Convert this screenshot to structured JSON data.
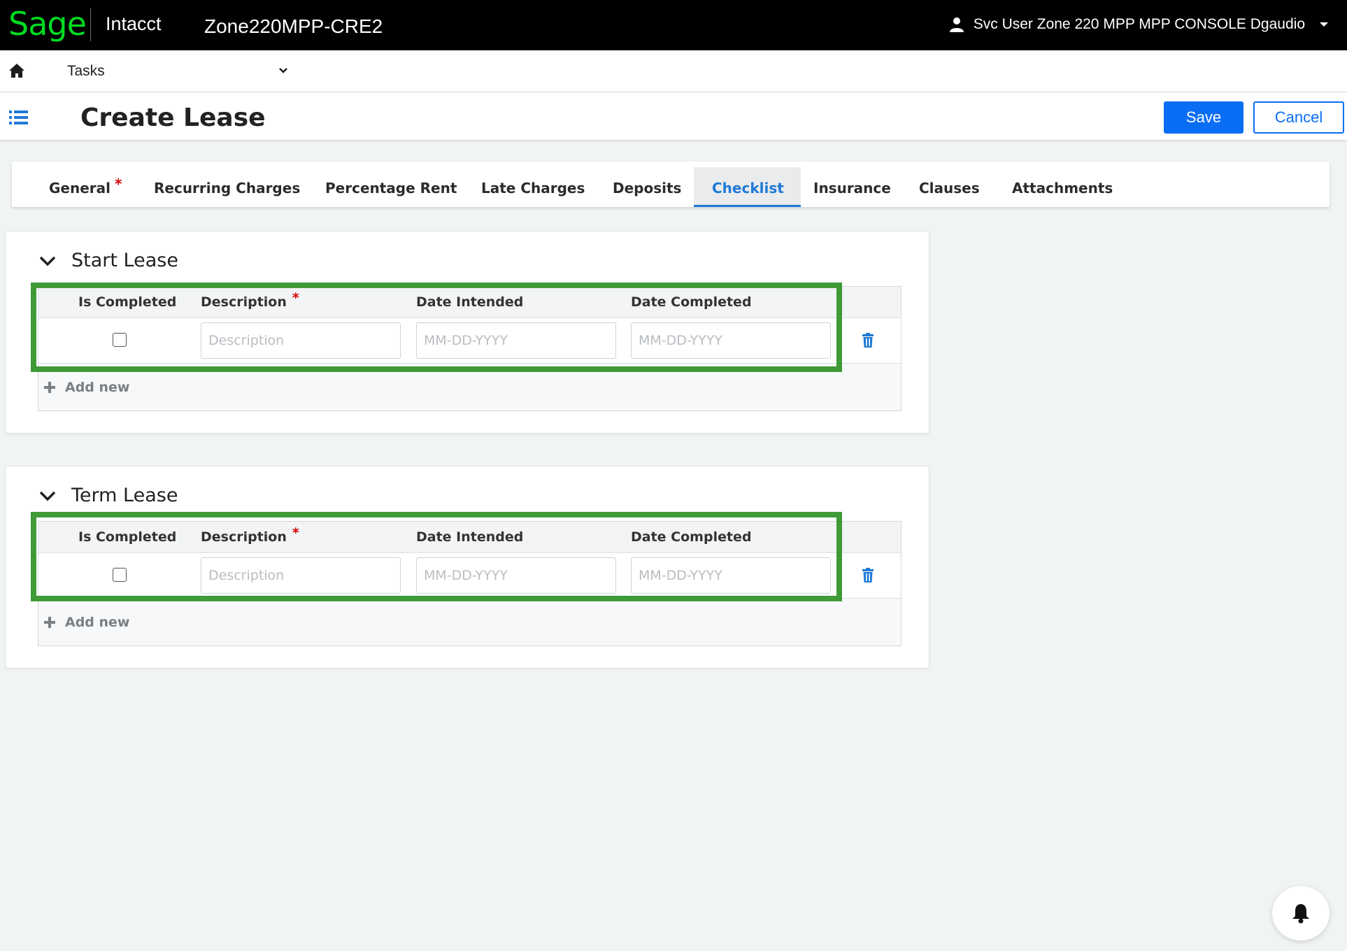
{
  "header": {
    "logo": "Sage",
    "product": "Intacct",
    "company": "Zone220MPP-CRE2",
    "user_name": "Svc User Zone 220 MPP MPP CONSOLE Dgaudio"
  },
  "nav": {
    "tasks_label": "Tasks"
  },
  "page": {
    "title": "Create Lease",
    "save_label": "Save",
    "cancel_label": "Cancel"
  },
  "tabs": [
    {
      "label": "General",
      "required_mark": "*"
    },
    {
      "label": "Recurring Charges"
    },
    {
      "label": "Percentage Rent"
    },
    {
      "label": "Late Charges"
    },
    {
      "label": "Deposits"
    },
    {
      "label": "Checklist",
      "active": true
    },
    {
      "label": "Insurance"
    },
    {
      "label": "Clauses"
    },
    {
      "label": "Attachments"
    }
  ],
  "sections": [
    {
      "title": "Start Lease",
      "columns": [
        "Is Completed",
        "Description",
        "Date Intended",
        "Date Completed"
      ],
      "required_mark": "*",
      "row": {
        "description_placeholder": "Description",
        "date_intended_placeholder": "MM-DD-YYYY",
        "date_completed_placeholder": "MM-DD-YYYY",
        "is_completed": false
      },
      "add_new_label": "Add new"
    },
    {
      "title": "Term Lease",
      "columns": [
        "Is Completed",
        "Description",
        "Date Intended",
        "Date Completed"
      ],
      "required_mark": "*",
      "row": {
        "description_placeholder": "Description",
        "date_intended_placeholder": "MM-DD-YYYY",
        "date_completed_placeholder": "MM-DD-YYYY",
        "is_completed": false
      },
      "add_new_label": "Add new"
    }
  ],
  "colors": {
    "brand_green": "#00dc22",
    "primary_blue": "#0a6ef5",
    "active_tab_blue": "#1f7ad6",
    "required_red": "#d40000",
    "highlight_green": "#3f9a38"
  },
  "icons": [
    "person-icon",
    "caret-down-icon",
    "home-icon",
    "chevron-down-icon",
    "list-icon",
    "trash-icon",
    "plus-icon",
    "bell-icon"
  ]
}
